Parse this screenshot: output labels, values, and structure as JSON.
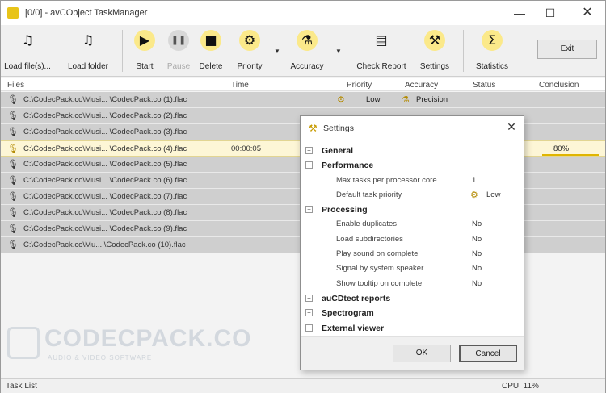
{
  "window": {
    "title": "[0/0] - avCObject TaskManager"
  },
  "toolbar": {
    "buttons": [
      {
        "label": "Load file(s)...",
        "glyph": "♫",
        "icon": "music-note-icon"
      },
      {
        "label": "Load folder",
        "glyph": "♫",
        "icon": "music-folder-icon"
      },
      {
        "label": "Start",
        "glyph": "▶",
        "icon": "play-icon"
      },
      {
        "label": "Pause",
        "glyph": "❚❚",
        "icon": "pause-icon"
      },
      {
        "label": "Delete",
        "glyph": "■",
        "icon": "stop-icon"
      },
      {
        "label": "Priority",
        "glyph": "⚙",
        "icon": "priority-icon"
      },
      {
        "label": "Accuracy",
        "glyph": "⚗",
        "icon": "microscope-icon"
      },
      {
        "label": "Check Report",
        "glyph": "▤",
        "icon": "report-icon"
      },
      {
        "label": "Settings",
        "glyph": "⚒",
        "icon": "settings-icon"
      },
      {
        "label": "Statistics",
        "glyph": "Σ",
        "icon": "sigma-icon"
      }
    ],
    "exit_label": "Exit"
  },
  "columns": {
    "files": "Files",
    "time": "Time",
    "priority": "Priority",
    "accuracy": "Accuracy",
    "status": "Status",
    "conclusion": "Conclusion"
  },
  "rows": [
    {
      "file": "C:\\CodecPack.co\\Musi... \\CodecPack.co (1).flac",
      "time": "",
      "priority": "Low",
      "accuracy": "Precision",
      "conclusion": ""
    },
    {
      "file": "C:\\CodecPack.co\\Musi... \\CodecPack.co (2).flac",
      "time": "",
      "priority": "",
      "accuracy": "",
      "conclusion": ""
    },
    {
      "file": "C:\\CodecPack.co\\Musi... \\CodecPack.co (3).flac",
      "time": "",
      "priority": "",
      "accuracy": "",
      "conclusion": ""
    },
    {
      "file": "C:\\CodecPack.co\\Musi... \\CodecPack.co (4).flac",
      "time": "00:00:05",
      "priority": "",
      "accuracy": "",
      "conclusion": "80%"
    },
    {
      "file": "C:\\CodecPack.co\\Musi... \\CodecPack.co (5).flac",
      "time": "",
      "priority": "",
      "accuracy": "",
      "conclusion": ""
    },
    {
      "file": "C:\\CodecPack.co\\Musi... \\CodecPack.co (6).flac",
      "time": "",
      "priority": "",
      "accuracy": "",
      "conclusion": ""
    },
    {
      "file": "C:\\CodecPack.co\\Musi... \\CodecPack.co (7).flac",
      "time": "",
      "priority": "",
      "accuracy": "",
      "conclusion": ""
    },
    {
      "file": "C:\\CodecPack.co\\Musi... \\CodecPack.co (8).flac",
      "time": "",
      "priority": "",
      "accuracy": "",
      "conclusion": ""
    },
    {
      "file": "C:\\CodecPack.co\\Musi... \\CodecPack.co (9).flac",
      "time": "",
      "priority": "",
      "accuracy": "",
      "conclusion": ""
    },
    {
      "file": "C:\\CodecPack.co\\Mu... \\CodecPack.co (10).flac",
      "time": "",
      "priority": "",
      "accuracy": "",
      "conclusion": ""
    }
  ],
  "watermark": {
    "text": "CODECPACK.CO",
    "subtext": "AUDIO & VIDEO SOFTWARE"
  },
  "status": {
    "left": "Task List",
    "right": "CPU: 11%"
  },
  "dialog": {
    "title": "Settings",
    "nodes": [
      {
        "kind": "group",
        "expander": "⊞",
        "label": "General"
      },
      {
        "kind": "group",
        "expander": "⊟",
        "label": "Performance"
      },
      {
        "kind": "item",
        "label": "Max tasks per processor core",
        "value": "1"
      },
      {
        "kind": "item",
        "label": "Default task priority",
        "value": "Low",
        "value_icon": "priority-icon"
      },
      {
        "kind": "group",
        "expander": "⊟",
        "label": "Processing"
      },
      {
        "kind": "item",
        "label": "Enable duplicates",
        "value": "No"
      },
      {
        "kind": "item",
        "label": "Load subdirectories",
        "value": "No"
      },
      {
        "kind": "item",
        "label": "Play sound on complete",
        "value": "No"
      },
      {
        "kind": "item",
        "label": "Signal by system speaker",
        "value": "No"
      },
      {
        "kind": "item",
        "label": "Show tooltip on complete",
        "value": "No"
      },
      {
        "kind": "group",
        "expander": "⊞",
        "label": "auCDtect reports"
      },
      {
        "kind": "group",
        "expander": "⊞",
        "label": "Spectrogram"
      },
      {
        "kind": "group",
        "expander": "⊞",
        "label": "External viewer"
      }
    ],
    "ok_label": "OK",
    "cancel_label": "Cancel"
  },
  "colors": {
    "accent": "#fbe98a",
    "row_gray": "#cfcfcf",
    "row_selected": "#fdf6d6"
  }
}
